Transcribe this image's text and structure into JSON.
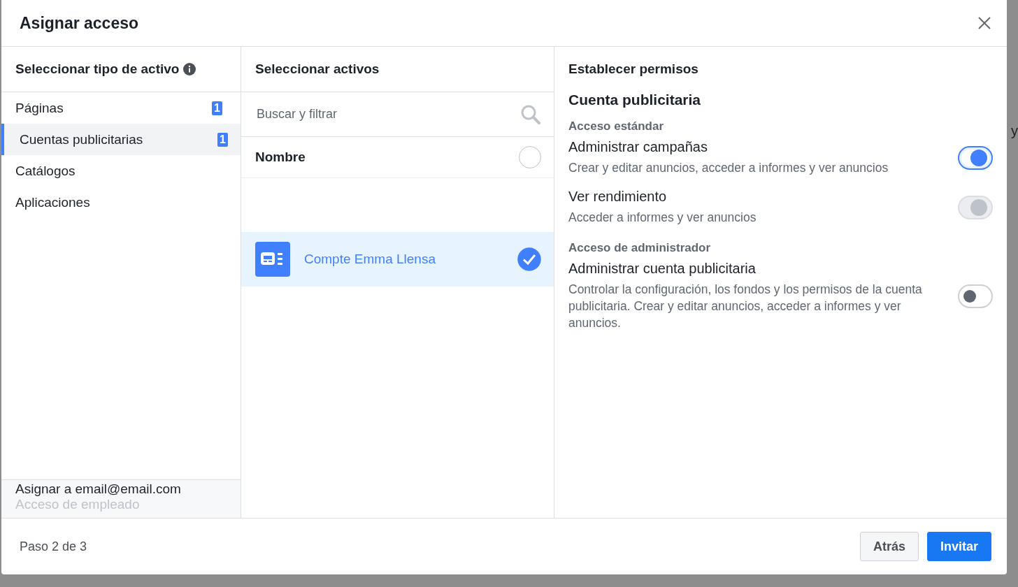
{
  "dialog": {
    "title": "Asignar acceso"
  },
  "asset_types": {
    "heading": "Seleccionar tipo de activo",
    "items": [
      {
        "label": "Páginas",
        "badge": "1",
        "selected": false
      },
      {
        "label": "Cuentas publicitarias",
        "badge": "1",
        "selected": true
      },
      {
        "label": "Catálogos",
        "selected": false
      },
      {
        "label": "Aplicaciones",
        "selected": false
      }
    ],
    "assignee": "Asignar a email@email.com",
    "role": "Acceso de empleado"
  },
  "assets": {
    "heading": "Seleccionar activos",
    "search": {
      "placeholder": "Buscar y filtrar"
    },
    "column": "Nombre",
    "select_all_checked": false,
    "rows": [
      {
        "name": "Compte Emma Llensa",
        "selected": true
      }
    ]
  },
  "permissions": {
    "heading": "Establecer permisos",
    "subject": "Cuenta publicitaria",
    "groups": [
      {
        "title": "Acceso estándar",
        "items": [
          {
            "name": "Administrar campañas",
            "description": "Crear y editar anuncios, acceder a informes y ver anuncios",
            "on": true,
            "disabled": false
          },
          {
            "name": "Ver rendimiento",
            "description": "Acceder a informes y ver anuncios",
            "on": true,
            "disabled": true
          }
        ]
      },
      {
        "title": "Acceso de administrador",
        "items": [
          {
            "name": "Administrar cuenta publicitaria",
            "description": "Controlar la configuración, los fondos y los permisos de la cuenta publicitaria. Crear y editar anuncios, acceder a informes y ver anuncios.",
            "on": false,
            "disabled": false
          }
        ]
      }
    ]
  },
  "footer": {
    "step": "Paso 2 de 3",
    "buttons": [
      {
        "label": "Atrás",
        "kind": "secondary"
      },
      {
        "label": "Invitar",
        "kind": "primary"
      }
    ]
  },
  "backdrop_text": "y"
}
